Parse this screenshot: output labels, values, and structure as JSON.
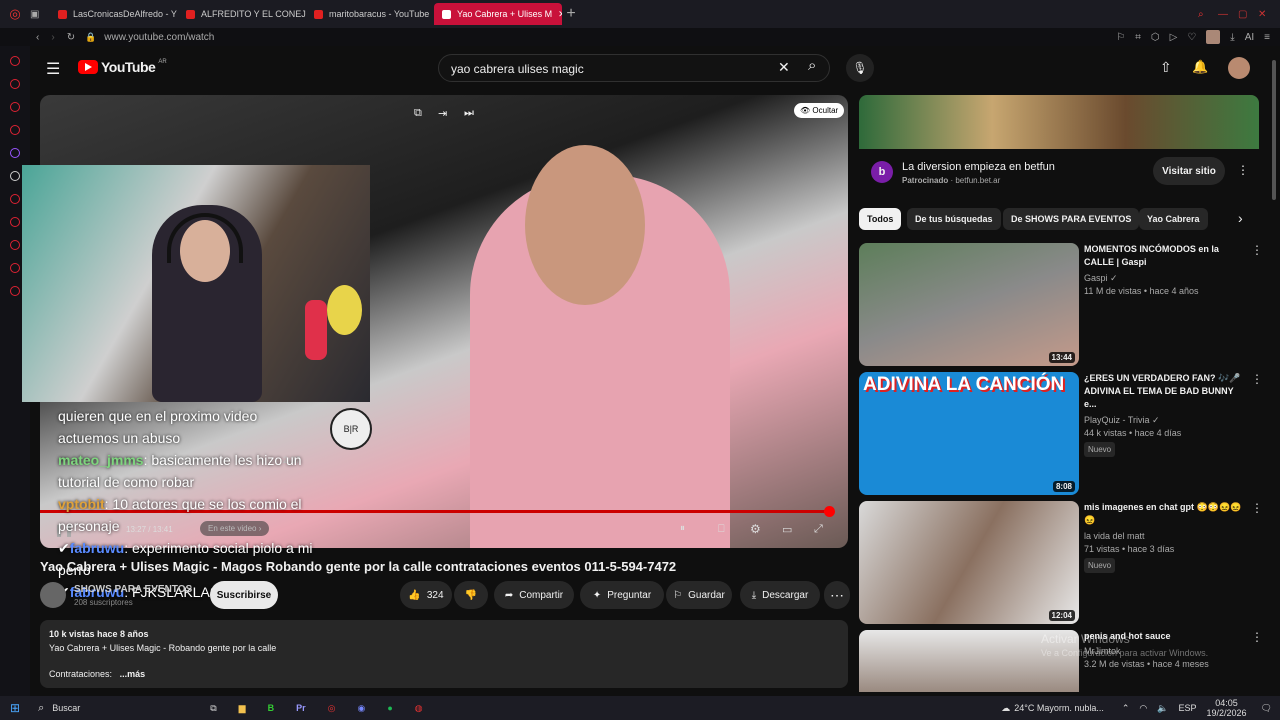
{
  "browser": {
    "tabs": [
      {
        "label": "LasCronicasDeAlfredo - Y"
      },
      {
        "label": "ALFREDITO Y EL CONEJO"
      },
      {
        "label": "maritobaracus - YouTube"
      },
      {
        "label": "Yao Cabrera + Ulises M"
      }
    ],
    "url": "www.youtube.com/watch"
  },
  "header": {
    "logo": "YouTube",
    "region": "AR",
    "search_value": "yao cabrera ulises magic"
  },
  "video": {
    "hide_label": "Ocultar",
    "time": "13:27 / 13:41",
    "chapter": "En este video",
    "overlay_time": "2:37",
    "title": "Yao Cabrera + Ulises Magic - Magos Robando gente por la calle contrataciones eventos 011-5-594-7472",
    "channel": "SHOWS PARA EVENTOS",
    "subscribers": "208 suscriptores",
    "subscribe_label": "Suscribirse",
    "likes": "324",
    "share_label": "Compartir",
    "ask_label": "Preguntar",
    "save_label": "Guardar",
    "download_label": "Descargar"
  },
  "chat": [
    {
      "name": "",
      "text": "quieren que en el proximo video actuemos un abuso"
    },
    {
      "name": "mateo_jmms",
      "text": ": basicamente les hizo un tutorial de como robar"
    },
    {
      "name": "vptobit",
      "text": ": 10 actores que se los comio el personaje"
    },
    {
      "name": "fabruwu",
      "text": ": experimento social piolo a mi perro"
    },
    {
      "name": "fabruwu",
      "text": ": FJKSLAKLASKFNASF"
    }
  ],
  "description": {
    "stats": "10 k vistas  hace 8 años",
    "line": "Yao Cabrera + Ulises Magic - Robando gente por la calle",
    "contact": "Contrataciones:",
    "more": "...más"
  },
  "ad": {
    "title": "La diversion empieza en betfun",
    "sponsored": "Patrocinado",
    "domain": "betfun.bet.ar",
    "cta": "Visitar sitio",
    "logo_letter": "b"
  },
  "chips": [
    "Todos",
    "De tus búsquedas",
    "De SHOWS PARA EVENTOS",
    "Yao Cabrera"
  ],
  "recommendations": [
    {
      "title": "MOMENTOS INCÓMODOS en la CALLE | Gaspi",
      "channel": "Gaspi",
      "views": "11 M de vistas • hace 4 años",
      "duration": "13:44",
      "badge": ""
    },
    {
      "title": "¿ERES UN VERDADERO FAN? 🎶🎤 ADIVINA EL TEMA DE BAD BUNNY e...",
      "channel": "PlayQuiz - Trivia",
      "views": "44 k vistas • hace 4 días",
      "duration": "8:08",
      "badge": "Nuevo",
      "thumb_text": "ADIVINA LA CANCIÓN"
    },
    {
      "title": "mis imagenes en chat gpt 😳😳😖😖😖",
      "channel": "la vida del matt",
      "views": "71 vistas • hace 3 días",
      "duration": "12:04",
      "badge": "Nuevo"
    },
    {
      "title": "penis and hot sauce",
      "channel": "MrJimtok",
      "views": "3.2 M de vistas • hace 4 meses",
      "duration": "",
      "badge": ""
    }
  ],
  "watermark": {
    "title": "Activar Windows",
    "sub": "Ve a Configuración para activar Windows."
  },
  "taskbar": {
    "search": "Buscar",
    "weather": "24°C  Mayorm. nubla...",
    "lang": "ESP",
    "time": "04:05",
    "date": "19/2/2026"
  },
  "colors": {
    "accent": "#ff0000",
    "browser_tab": "#c9113a",
    "background": "#0f0f0f"
  }
}
